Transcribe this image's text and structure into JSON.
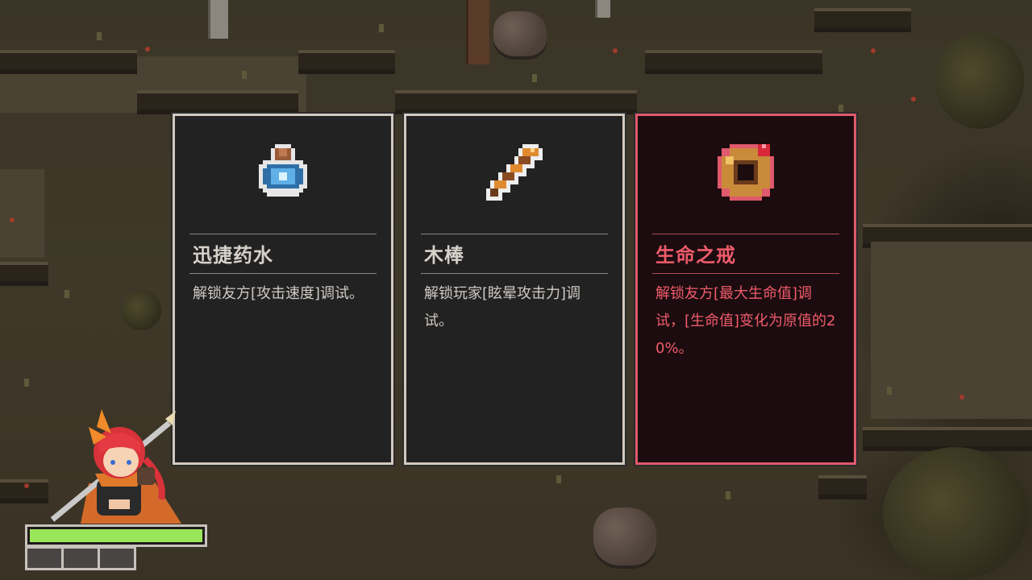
{
  "cards": [
    {
      "name": "迅捷药水",
      "description": "解锁友方[攻击速度]调试。",
      "icon": "blue-potion-icon",
      "selected": false
    },
    {
      "name": "木棒",
      "description": "解锁玩家[眩晕攻击力]调试。",
      "icon": "wooden-club-icon",
      "selected": false
    },
    {
      "name": "生命之戒",
      "description": "解锁友方[最大生命值]调试，[生命值]变化为原值的20%。",
      "icon": "life-ring-icon",
      "selected": true
    }
  ],
  "player": {
    "portrait": "red-haired-heroine-avatar",
    "health_fraction": 1.0,
    "mana_slots_total": 3,
    "mana_slots_filled": 0
  },
  "colors": {
    "card_border": "#d2c9c0",
    "selected_border": "#e0596c",
    "selected_text": "#ef5b6b",
    "health_bar": "#9ae65a"
  }
}
